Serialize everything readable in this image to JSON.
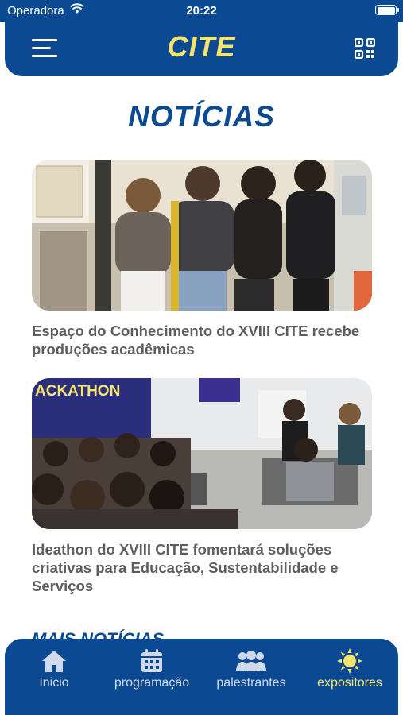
{
  "status_bar": {
    "carrier": "Operadora",
    "time": "20:22"
  },
  "header": {
    "brand": "CITE",
    "menu_icon": "hamburger-menu-icon",
    "qr_icon": "qr-code-icon"
  },
  "page_title": "NOTÍCIAS",
  "news": [
    {
      "title": "Espaço do Conhecimento do XVIII CITE recebe produções acadêmicas"
    },
    {
      "title": "Ideathon do XVIII CITE fomentará soluções criativas para Educação, Sustentabilidade e Serviços",
      "banner_text": "ACKATHON"
    }
  ],
  "more_news_label": "MAIS NOTÍCIAS",
  "bottom_nav": [
    {
      "label": "Inicio",
      "icon": "home-icon",
      "active": false
    },
    {
      "label": "programação",
      "icon": "calendar-icon",
      "active": false
    },
    {
      "label": "palestrantes",
      "icon": "people-icon",
      "active": false
    },
    {
      "label": "expositores",
      "icon": "sun-icon",
      "active": true
    }
  ],
  "colors": {
    "primary": "#0b4a93",
    "accent": "#f5e66b",
    "text_gray": "#5e5e5e"
  }
}
